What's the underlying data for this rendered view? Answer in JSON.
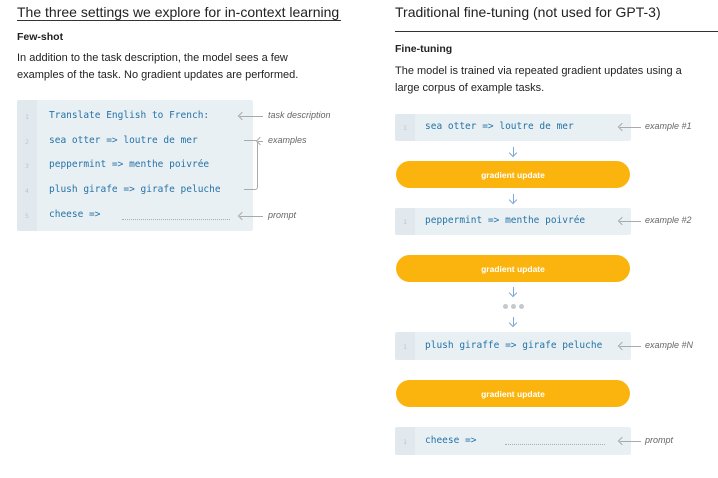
{
  "left": {
    "title": "The three settings we explore for in-context learning",
    "subhead": "Few-shot",
    "description": "In addition to the task description, the model sees a few examples of the task. No gradient updates are performed.",
    "code_lines": [
      {
        "num": "1",
        "text": "Translate English to French:"
      },
      {
        "num": "2",
        "text": "sea otter => loutre de mer"
      },
      {
        "num": "3",
        "text": "peppermint => menthe poivrée"
      },
      {
        "num": "4",
        "text": "plush girafe => girafe peluche"
      },
      {
        "num": "5",
        "text": "cheese =>"
      }
    ],
    "annotations": {
      "task_description": "task description",
      "examples": "examples",
      "prompt": "prompt"
    }
  },
  "right": {
    "title": "Traditional fine-tuning (not used for GPT-3)",
    "subhead": "Fine-tuning",
    "description": "The model is trained via repeated gradient updates using a large corpus of example tasks.",
    "boxes": [
      {
        "num": "1",
        "text": "sea otter => loutre de mer",
        "annotation": "example #1"
      },
      {
        "num": "1",
        "text": "peppermint => menthe poivrée",
        "annotation": "example #2"
      },
      {
        "num": "1",
        "text": "plush giraffe => girafe peluche",
        "annotation": "example #N"
      },
      {
        "num": "1",
        "text": "cheese =>",
        "annotation": "prompt"
      }
    ],
    "gradient_label": "gradient update"
  },
  "colors": {
    "code_text": "#2573a7",
    "code_bg": "#e9f0f4",
    "pill": "#fbb40e",
    "arrow": "#7fa9d4"
  }
}
